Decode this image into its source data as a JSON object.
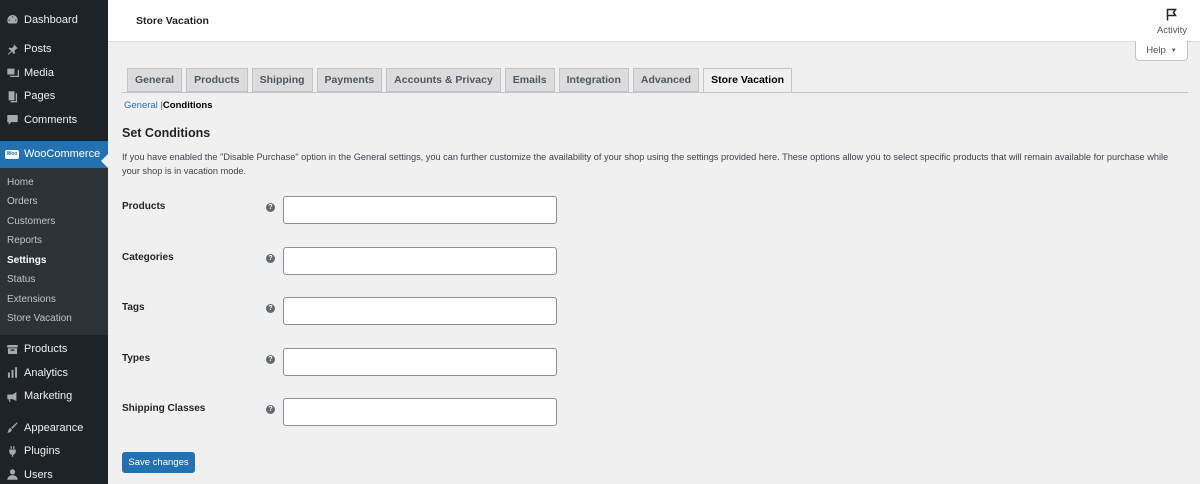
{
  "sidebar": {
    "top_items": [
      {
        "label": "Dashboard",
        "icon": "dashboard-icon"
      },
      {
        "label": "Posts",
        "icon": "pin-icon"
      },
      {
        "label": "Media",
        "icon": "media-icon"
      },
      {
        "label": "Pages",
        "icon": "page-icon"
      },
      {
        "label": "Comments",
        "icon": "comment-icon"
      }
    ],
    "woocommerce": {
      "label": "WooCommerce",
      "badge": "Woo"
    },
    "submenu": [
      "Home",
      "Orders",
      "Customers",
      "Reports",
      "Settings",
      "Status",
      "Extensions",
      "Store Vacation"
    ],
    "current_submenu": "Settings",
    "after_items": [
      {
        "label": "Products",
        "icon": "archive-icon"
      },
      {
        "label": "Analytics",
        "icon": "analytics-icon"
      },
      {
        "label": "Marketing",
        "icon": "megaphone-icon"
      }
    ],
    "bottom_items": [
      {
        "label": "Appearance",
        "icon": "brush-icon"
      },
      {
        "label": "Plugins",
        "icon": "plugin-icon"
      },
      {
        "label": "Users",
        "icon": "user-icon"
      }
    ]
  },
  "topbar": {
    "title": "Store Vacation",
    "activity_label": "Activity"
  },
  "help": {
    "label": "Help"
  },
  "tabs": [
    "General",
    "Products",
    "Shipping",
    "Payments",
    "Accounts & Privacy",
    "Emails",
    "Integration",
    "Advanced",
    "Store Vacation"
  ],
  "active_tab": "Store Vacation",
  "subnav": {
    "general": "General",
    "separator": "|",
    "conditions": "Conditions"
  },
  "section": {
    "title": "Set Conditions",
    "description": "If you have enabled the \"Disable Purchase\" option in the General settings, you can further customize the availability of your shop using the settings provided here. These options allow you to select specific products that will remain available for purchase while your shop is in vacation mode."
  },
  "fields": [
    {
      "label": "Products",
      "value": ""
    },
    {
      "label": "Categories",
      "value": ""
    },
    {
      "label": "Tags",
      "value": ""
    },
    {
      "label": "Types",
      "value": ""
    },
    {
      "label": "Shipping Classes",
      "value": ""
    }
  ],
  "help_tip_glyph": "?",
  "save_label": "Save changes",
  "colors": {
    "sidebar_bg": "#1d2327",
    "accent": "#2271b1",
    "page_bg": "#f0f0f1"
  }
}
